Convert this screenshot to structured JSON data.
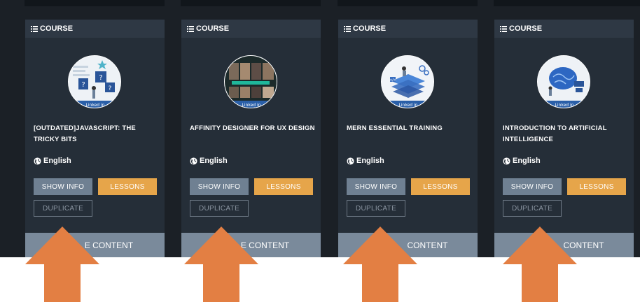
{
  "colors": {
    "page_bg": "#1b2026",
    "card_bg": "#252e38",
    "header_bg": "#2e3844",
    "info_button": "#6f8092",
    "lessons_button": "#e6a54a",
    "content_bar": "#7a8a9b",
    "arrow": "#e37f43"
  },
  "icons": {
    "header": "list-icon",
    "language": "globe-icon",
    "thumbnail_badge": "linkedin-logo",
    "annotation": "up-arrow"
  },
  "cards": [
    {
      "header": "COURSE",
      "title": "[OUTDATED]JAVASCRIPT: THE TRICKY BITS",
      "language": "English",
      "show_info": "SHOW INFO",
      "lessons": "LESSONS",
      "duplicate": "DUPLICATE",
      "content": "E CONTENT",
      "thumb_badge": "Linked in"
    },
    {
      "header": "COURSE",
      "title": "AFFINITY DESIGNER FOR UX DESIGN",
      "language": "English",
      "show_info": "SHOW INFO",
      "lessons": "LESSONS",
      "duplicate": "DUPLICATE",
      "content": "E CONTENT",
      "thumb_badge": "Linked in"
    },
    {
      "header": "COURSE",
      "title": "MERN ESSENTIAL TRAINING",
      "language": "English",
      "show_info": "SHOW INFO",
      "lessons": "LESSONS",
      "duplicate": "DUPLICATE",
      "content": "CONTENT",
      "thumb_badge": "Linked in"
    },
    {
      "header": "COURSE",
      "title": "INTRODUCTION TO ARTIFICIAL INTELLIGENCE",
      "language": "English",
      "show_info": "SHOW INFO",
      "lessons": "LESSONS",
      "duplicate": "DUPLICATE",
      "content": "CONTENT",
      "thumb_badge": "Linked in"
    }
  ]
}
